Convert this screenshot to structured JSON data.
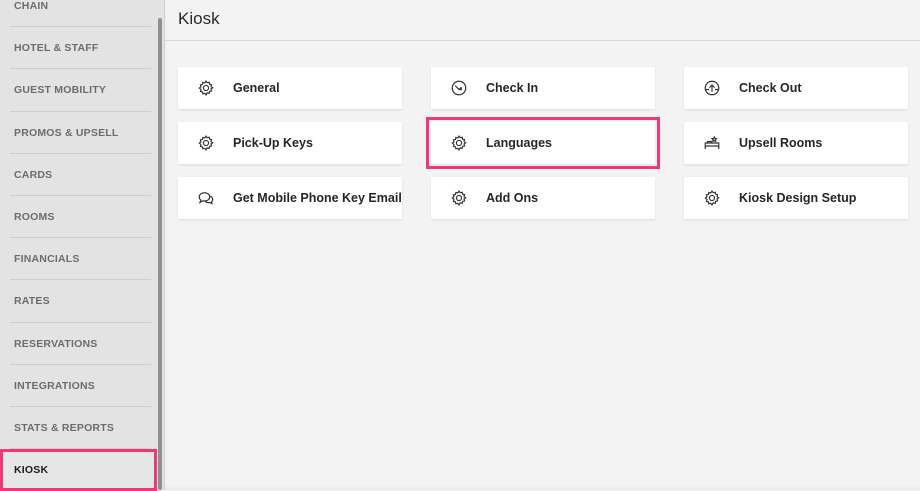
{
  "sidebar": {
    "items": [
      {
        "label": "CHAIN"
      },
      {
        "label": "HOTEL & STAFF"
      },
      {
        "label": "GUEST MOBILITY"
      },
      {
        "label": "PROMOS & UPSELL"
      },
      {
        "label": "CARDS"
      },
      {
        "label": "ROOMS"
      },
      {
        "label": "FINANCIALS"
      },
      {
        "label": "RATES"
      },
      {
        "label": "RESERVATIONS"
      },
      {
        "label": "INTEGRATIONS"
      },
      {
        "label": "STATS & REPORTS"
      },
      {
        "label": "KIOSK",
        "active": true
      }
    ]
  },
  "main": {
    "title": "Kiosk",
    "tiles": [
      {
        "label": "General",
        "icon": "gear-icon"
      },
      {
        "label": "Check In",
        "icon": "check-in-icon"
      },
      {
        "label": "Check Out",
        "icon": "check-out-icon"
      },
      {
        "label": "Pick-Up Keys",
        "icon": "gear-icon"
      },
      {
        "label": "Languages",
        "icon": "gear-icon",
        "highlighted": true
      },
      {
        "label": "Upsell Rooms",
        "icon": "upsell-bed-icon"
      },
      {
        "label": "Get Mobile Phone Key Email",
        "icon": "chat-bubbles-icon"
      },
      {
        "label": "Add Ons",
        "icon": "gear-icon"
      },
      {
        "label": "Kiosk Design Setup",
        "icon": "gear-icon"
      }
    ]
  },
  "colors": {
    "highlight": "#ee3a74",
    "sidebar_bg": "#e3e3e3",
    "page_bg": "#f3f3f3"
  }
}
